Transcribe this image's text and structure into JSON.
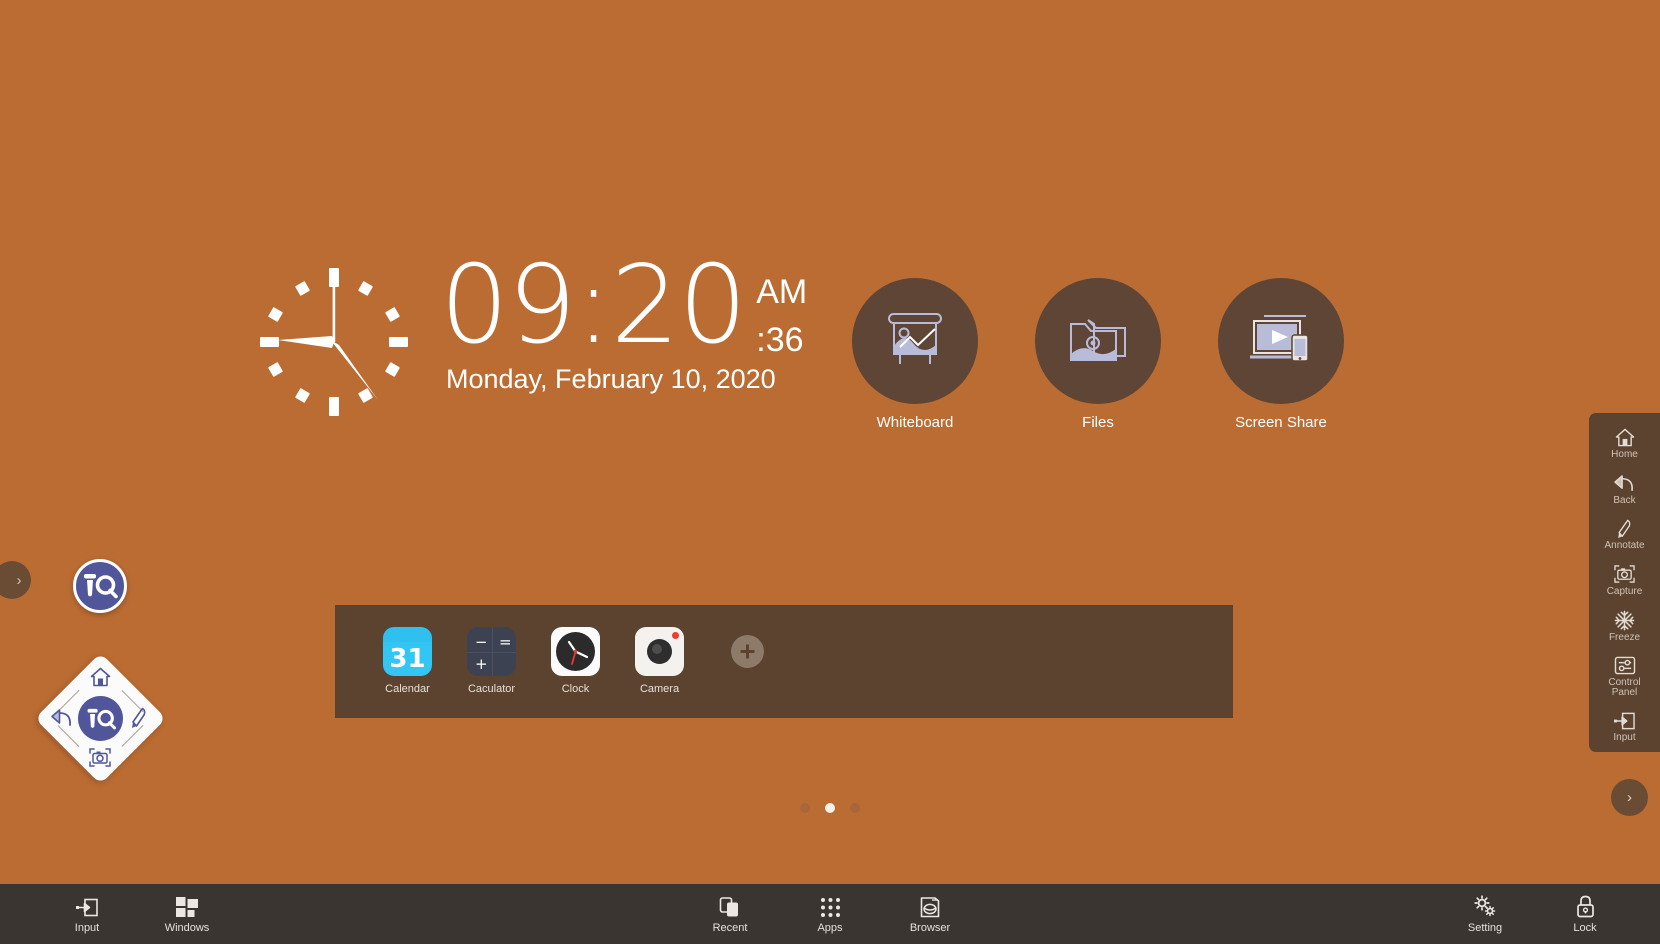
{
  "theme": {
    "desktop_bg": "#bb6c33",
    "panel_bg": "#5b432f",
    "taskbar_bg": "#3b3532",
    "shortcut_circle_bg": "#5f4535",
    "icon_line_color": "#b9bcd8",
    "iq_blue": "#51569b",
    "text_white": "#ffffff"
  },
  "clock": {
    "time": "09:20",
    "ampm": "AM",
    "seconds": ":36",
    "date": "Monday, February 10, 2020",
    "analog": {
      "hour_hand_deg": 280,
      "minute_hand_deg": 120,
      "second_hand_deg": 0,
      "tick_count": 12
    }
  },
  "shortcuts": [
    {
      "label": "Whiteboard",
      "icon": "whiteboard-icon"
    },
    {
      "label": "Files",
      "icon": "folder-icon"
    },
    {
      "label": "Screen Share",
      "icon": "screen-share-icon"
    }
  ],
  "dock": {
    "apps": [
      {
        "label": "Calendar",
        "icon": "calendar-icon",
        "badge": "31"
      },
      {
        "label": "Caculator",
        "icon": "calculator-icon",
        "symbols": [
          "−",
          "=",
          "+"
        ]
      },
      {
        "label": "Clock",
        "icon": "clock-icon"
      },
      {
        "label": "Camera",
        "icon": "camera-icon"
      }
    ],
    "add_label": "+"
  },
  "page_indicator": {
    "total": 3,
    "active_index": 1
  },
  "floating_menu": {
    "logo_text": "iQ",
    "items": [
      {
        "label": "Home",
        "icon": "home-icon",
        "position": "top"
      },
      {
        "label": "Back",
        "icon": "back-icon",
        "position": "left"
      },
      {
        "label": "Annotate",
        "icon": "pen-icon",
        "position": "right"
      },
      {
        "label": "Capture",
        "icon": "capture-icon",
        "position": "bottom"
      }
    ]
  },
  "left_edge_tab": {
    "chevron": "›"
  },
  "right_edge_tab": {
    "chevron": "›"
  },
  "right_sidebar": {
    "items": [
      {
        "label": "Home",
        "icon": "home-icon"
      },
      {
        "label": "Back",
        "icon": "back-icon"
      },
      {
        "label": "Annotate",
        "icon": "pen-icon"
      },
      {
        "label": "Capture",
        "icon": "capture-icon"
      },
      {
        "label": "Freeze",
        "icon": "snowflake-icon"
      },
      {
        "label": "Control\nPanel",
        "icon": "control-panel-icon"
      },
      {
        "label": "Input",
        "icon": "input-icon"
      }
    ]
  },
  "taskbar": {
    "left": [
      {
        "label": "Input",
        "icon": "input-icon"
      },
      {
        "label": "Windows",
        "icon": "windows-icon"
      }
    ],
    "center": [
      {
        "label": "Recent",
        "icon": "recent-icon"
      },
      {
        "label": "Apps",
        "icon": "apps-grid-icon"
      },
      {
        "label": "Browser",
        "icon": "browser-icon"
      }
    ],
    "right": [
      {
        "label": "Setting",
        "icon": "gear-icon"
      },
      {
        "label": "Lock",
        "icon": "lock-icon"
      }
    ]
  }
}
